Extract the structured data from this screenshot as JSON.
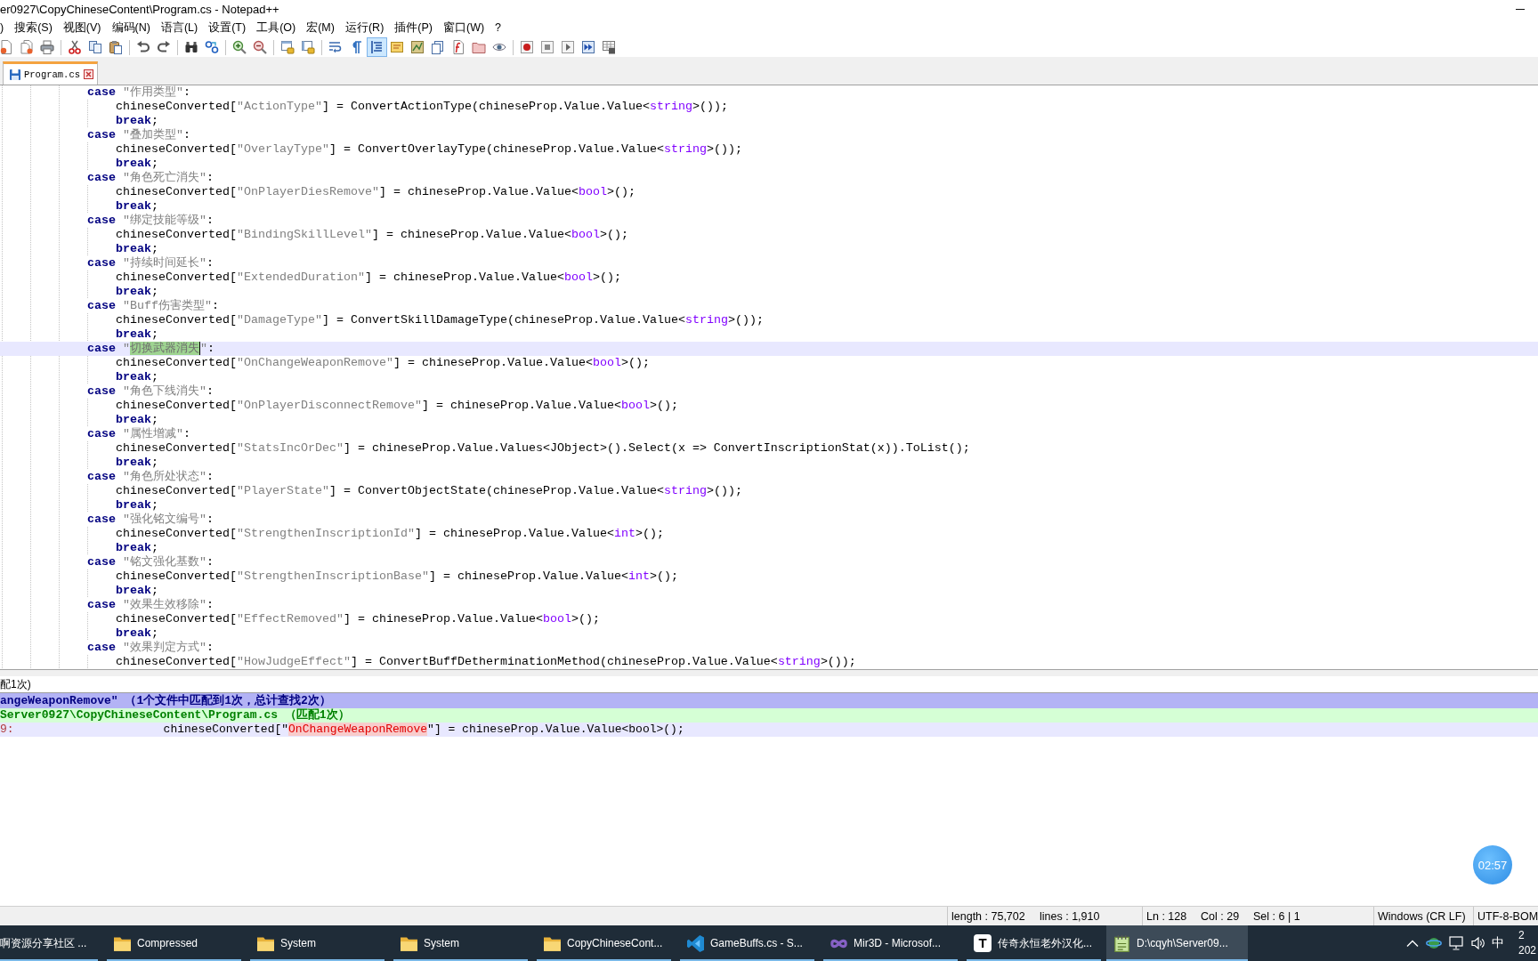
{
  "window": {
    "title": "er0927\\CopyChineseContent\\Program.cs - Notepad++"
  },
  "menu": [
    ")",
    "搜索(S)",
    "视图(V)",
    "编码(N)",
    "语言(L)",
    "设置(T)",
    "工具(O)",
    "宏(M)",
    "运行(R)",
    "插件(P)",
    "窗口(W)",
    "?"
  ],
  "toolbar": [
    [
      {
        "pressed": false
      },
      {
        "pressed": false
      },
      {
        "pressed": false
      }
    ],
    [
      {
        "pressed": false
      },
      {
        "pressed": false
      },
      {
        "pressed": false
      }
    ],
    [
      {
        "pressed": false
      },
      {
        "pressed": false
      }
    ],
    [
      {
        "pressed": false
      },
      {
        "pressed": false
      }
    ],
    [
      {
        "pressed": false
      },
      {
        "pressed": false
      }
    ],
    [
      {
        "pressed": false
      },
      {
        "pressed": false
      }
    ],
    [
      {
        "pressed": false
      },
      {
        "pressed": false
      },
      {
        "pressed": true
      },
      {
        "pressed": false
      },
      {
        "pressed": false
      },
      {
        "pressed": false
      },
      {
        "pressed": false
      },
      {
        "pressed": false
      },
      {
        "pressed": false
      }
    ],
    [
      {
        "pressed": false
      },
      {
        "pressed": false
      },
      {
        "pressed": false
      },
      {
        "pressed": false
      },
      {
        "pressed": false
      }
    ]
  ],
  "tabs": [
    {
      "label": "Program.cs",
      "selected": true
    }
  ],
  "editor": {
    "cases": [
      {
        "current": false,
        "tokens": [
          {
            "kind": "kw",
            "text": "case"
          },
          {
            "kind": "str",
            "text": " \"作用类型\""
          },
          {
            "kind": "code",
            "text": ":"
          }
        ],
        "children": [
          {
            "tokens": [
              {
                "kind": "code",
                "text": "chineseConverted["
              },
              {
                "kind": "str",
                "text": "\"ActionType\""
              },
              {
                "kind": "code",
                "text": "] = ConvertActionType(chineseProp.Value.Value<"
              },
              {
                "kind": "type",
                "text": "string"
              },
              {
                "kind": "code",
                "text": ">());"
              }
            ]
          },
          {
            "tokens": [
              {
                "kind": "kw",
                "text": "break"
              },
              {
                "kind": "code",
                "text": ";"
              }
            ]
          }
        ]
      },
      {
        "current": false,
        "tokens": [
          {
            "kind": "kw",
            "text": "case"
          },
          {
            "kind": "str",
            "text": " \"叠加类型\""
          },
          {
            "kind": "code",
            "text": ":"
          }
        ],
        "children": [
          {
            "tokens": [
              {
                "kind": "code",
                "text": "chineseConverted["
              },
              {
                "kind": "str",
                "text": "\"OverlayType\""
              },
              {
                "kind": "code",
                "text": "] = ConvertOverlayType(chineseProp.Value.Value<"
              },
              {
                "kind": "type",
                "text": "string"
              },
              {
                "kind": "code",
                "text": ">());"
              }
            ]
          },
          {
            "tokens": [
              {
                "kind": "kw",
                "text": "break"
              },
              {
                "kind": "code",
                "text": ";"
              }
            ]
          }
        ]
      },
      {
        "current": false,
        "tokens": [
          {
            "kind": "kw",
            "text": "case"
          },
          {
            "kind": "str",
            "text": " \"角色死亡消失\""
          },
          {
            "kind": "code",
            "text": ":"
          }
        ],
        "children": [
          {
            "tokens": [
              {
                "kind": "code",
                "text": "chineseConverted["
              },
              {
                "kind": "str",
                "text": "\"OnPlayerDiesRemove\""
              },
              {
                "kind": "code",
                "text": "] = chineseProp.Value.Value<"
              },
              {
                "kind": "type",
                "text": "bool"
              },
              {
                "kind": "code",
                "text": ">();"
              }
            ]
          },
          {
            "tokens": [
              {
                "kind": "kw",
                "text": "break"
              },
              {
                "kind": "code",
                "text": ";"
              }
            ]
          }
        ]
      },
      {
        "current": false,
        "tokens": [
          {
            "kind": "kw",
            "text": "case"
          },
          {
            "kind": "str",
            "text": " \"绑定技能等级\""
          },
          {
            "kind": "code",
            "text": ":"
          }
        ],
        "children": [
          {
            "tokens": [
              {
                "kind": "code",
                "text": "chineseConverted["
              },
              {
                "kind": "str",
                "text": "\"BindingSkillLevel\""
              },
              {
                "kind": "code",
                "text": "] = chineseProp.Value.Value<"
              },
              {
                "kind": "type",
                "text": "bool"
              },
              {
                "kind": "code",
                "text": ">();"
              }
            ]
          },
          {
            "tokens": [
              {
                "kind": "kw",
                "text": "break"
              },
              {
                "kind": "code",
                "text": ";"
              }
            ]
          }
        ]
      },
      {
        "current": false,
        "tokens": [
          {
            "kind": "kw",
            "text": "case"
          },
          {
            "kind": "str",
            "text": " \"持续时间延长\""
          },
          {
            "kind": "code",
            "text": ":"
          }
        ],
        "children": [
          {
            "tokens": [
              {
                "kind": "code",
                "text": "chineseConverted["
              },
              {
                "kind": "str",
                "text": "\"ExtendedDuration\""
              },
              {
                "kind": "code",
                "text": "] = chineseProp.Value.Value<"
              },
              {
                "kind": "type",
                "text": "bool"
              },
              {
                "kind": "code",
                "text": ">();"
              }
            ]
          },
          {
            "tokens": [
              {
                "kind": "kw",
                "text": "break"
              },
              {
                "kind": "code",
                "text": ";"
              }
            ]
          }
        ]
      },
      {
        "current": false,
        "tokens": [
          {
            "kind": "kw",
            "text": "case"
          },
          {
            "kind": "str",
            "text": " \"Buff伤害类型\""
          },
          {
            "kind": "code",
            "text": ":"
          }
        ],
        "children": [
          {
            "tokens": [
              {
                "kind": "code",
                "text": "chineseConverted["
              },
              {
                "kind": "str",
                "text": "\"DamageType\""
              },
              {
                "kind": "code",
                "text": "] = ConvertSkillDamageType(chineseProp.Value.Value<"
              },
              {
                "kind": "type",
                "text": "string"
              },
              {
                "kind": "code",
                "text": ">());"
              }
            ]
          },
          {
            "tokens": [
              {
                "kind": "kw",
                "text": "break"
              },
              {
                "kind": "code",
                "text": ";"
              }
            ]
          }
        ]
      },
      {
        "current": true,
        "tokens": [
          {
            "kind": "kw",
            "text": "case"
          },
          {
            "kind": "str",
            "text": " \""
          },
          {
            "kind": "sel",
            "text": "切换武器消失"
          },
          {
            "kind": "str",
            "text": "\""
          },
          {
            "kind": "code",
            "text": ":"
          }
        ],
        "children": [
          {
            "tokens": [
              {
                "kind": "code",
                "text": "chineseConverted["
              },
              {
                "kind": "str",
                "text": "\"OnChangeWeaponRemove\""
              },
              {
                "kind": "code",
                "text": "] = chineseProp.Value.Value<"
              },
              {
                "kind": "type",
                "text": "bool"
              },
              {
                "kind": "code",
                "text": ">();"
              }
            ]
          },
          {
            "tokens": [
              {
                "kind": "kw",
                "text": "break"
              },
              {
                "kind": "code",
                "text": ";"
              }
            ]
          }
        ]
      },
      {
        "current": false,
        "tokens": [
          {
            "kind": "kw",
            "text": "case"
          },
          {
            "kind": "str",
            "text": " \"角色下线消失\""
          },
          {
            "kind": "code",
            "text": ":"
          }
        ],
        "children": [
          {
            "tokens": [
              {
                "kind": "code",
                "text": "chineseConverted["
              },
              {
                "kind": "str",
                "text": "\"OnPlayerDisconnectRemove\""
              },
              {
                "kind": "code",
                "text": "] = chineseProp.Value.Value<"
              },
              {
                "kind": "type",
                "text": "bool"
              },
              {
                "kind": "code",
                "text": ">();"
              }
            ]
          },
          {
            "tokens": [
              {
                "kind": "kw",
                "text": "break"
              },
              {
                "kind": "code",
                "text": ";"
              }
            ]
          }
        ]
      },
      {
        "current": false,
        "tokens": [
          {
            "kind": "kw",
            "text": "case"
          },
          {
            "kind": "str",
            "text": " \"属性增减\""
          },
          {
            "kind": "code",
            "text": ":"
          }
        ],
        "children": [
          {
            "tokens": [
              {
                "kind": "code",
                "text": "chineseConverted["
              },
              {
                "kind": "str",
                "text": "\"StatsIncOrDec\""
              },
              {
                "kind": "code",
                "text": "] = chineseProp.Value.Values<JObject>().Select(x => ConvertInscriptionStat(x)).ToList();"
              }
            ]
          },
          {
            "tokens": [
              {
                "kind": "kw",
                "text": "break"
              },
              {
                "kind": "code",
                "text": ";"
              }
            ]
          }
        ]
      },
      {
        "current": false,
        "tokens": [
          {
            "kind": "kw",
            "text": "case"
          },
          {
            "kind": "str",
            "text": " \"角色所处状态\""
          },
          {
            "kind": "code",
            "text": ":"
          }
        ],
        "children": [
          {
            "tokens": [
              {
                "kind": "code",
                "text": "chineseConverted["
              },
              {
                "kind": "str",
                "text": "\"PlayerState\""
              },
              {
                "kind": "code",
                "text": "] = ConvertObjectState(chineseProp.Value.Value<"
              },
              {
                "kind": "type",
                "text": "string"
              },
              {
                "kind": "code",
                "text": ">());"
              }
            ]
          },
          {
            "tokens": [
              {
                "kind": "kw",
                "text": "break"
              },
              {
                "kind": "code",
                "text": ";"
              }
            ]
          }
        ]
      },
      {
        "current": false,
        "tokens": [
          {
            "kind": "kw",
            "text": "case"
          },
          {
            "kind": "str",
            "text": " \"强化铭文编号\""
          },
          {
            "kind": "code",
            "text": ":"
          }
        ],
        "children": [
          {
            "tokens": [
              {
                "kind": "code",
                "text": "chineseConverted["
              },
              {
                "kind": "str",
                "text": "\"StrengthenInscriptionId\""
              },
              {
                "kind": "code",
                "text": "] = chineseProp.Value.Value<"
              },
              {
                "kind": "type",
                "text": "int"
              },
              {
                "kind": "code",
                "text": ">();"
              }
            ]
          },
          {
            "tokens": [
              {
                "kind": "kw",
                "text": "break"
              },
              {
                "kind": "code",
                "text": ";"
              }
            ]
          }
        ]
      },
      {
        "current": false,
        "tokens": [
          {
            "kind": "kw",
            "text": "case"
          },
          {
            "kind": "str",
            "text": " \"铭文强化基数\""
          },
          {
            "kind": "code",
            "text": ":"
          }
        ],
        "children": [
          {
            "tokens": [
              {
                "kind": "code",
                "text": "chineseConverted["
              },
              {
                "kind": "str",
                "text": "\"StrengthenInscriptionBase\""
              },
              {
                "kind": "code",
                "text": "] = chineseProp.Value.Value<"
              },
              {
                "kind": "type",
                "text": "int"
              },
              {
                "kind": "code",
                "text": ">();"
              }
            ]
          },
          {
            "tokens": [
              {
                "kind": "kw",
                "text": "break"
              },
              {
                "kind": "code",
                "text": ";"
              }
            ]
          }
        ]
      },
      {
        "current": false,
        "tokens": [
          {
            "kind": "kw",
            "text": "case"
          },
          {
            "kind": "str",
            "text": " \"效果生效移除\""
          },
          {
            "kind": "code",
            "text": ":"
          }
        ],
        "children": [
          {
            "tokens": [
              {
                "kind": "code",
                "text": "chineseConverted["
              },
              {
                "kind": "str",
                "text": "\"EffectRemoved\""
              },
              {
                "kind": "code",
                "text": "] = chineseProp.Value.Value<"
              },
              {
                "kind": "type",
                "text": "bool"
              },
              {
                "kind": "code",
                "text": ">();"
              }
            ]
          },
          {
            "tokens": [
              {
                "kind": "kw",
                "text": "break"
              },
              {
                "kind": "code",
                "text": ";"
              }
            ]
          }
        ]
      },
      {
        "current": false,
        "tokens": [
          {
            "kind": "kw",
            "text": "case"
          },
          {
            "kind": "str",
            "text": " \"效果判定方式\""
          },
          {
            "kind": "code",
            "text": ":"
          }
        ],
        "children": [
          {
            "tokens": [
              {
                "kind": "code",
                "text": "chineseConverted["
              },
              {
                "kind": "str",
                "text": "\"HowJudgeEffect\""
              },
              {
                "kind": "code",
                "text": "] = ConvertBuffDetherminationMethod(chineseProp.Value.Value<"
              },
              {
                "kind": "type",
                "text": "string"
              },
              {
                "kind": "code",
                "text": ">());"
              }
            ]
          }
        ]
      }
    ]
  },
  "search_results": {
    "title": "配1次)",
    "summary": "angeWeaponRemove\" （1个文件中匹配到1次，总计查找2次）",
    "file": "Server0927\\CopyChineseContent\\Program.cs （匹配1次）",
    "hits": [
      {
        "current": true,
        "line_number": "9:",
        "tokens": [
          {
            "kind": "code",
            "text": "chineseConverted[\""
          },
          {
            "kind": "match",
            "text": "OnChangeWeaponRemove"
          },
          {
            "kind": "code",
            "text": "\"] = chineseProp.Value.Value<bool>();"
          }
        ]
      }
    ]
  },
  "status_bar": {
    "length": "length : 75,702",
    "lines": "lines : 1,910",
    "line": "Ln : 128",
    "column": "Col : 29",
    "selection": "Sel : 6 | 1",
    "eol": "Windows (CR LF)",
    "encoding": "UTF-8-BOM"
  },
  "taskbar": {
    "items": [
      {
        "kind": "label",
        "label": "啊资源分享社区 ...",
        "running": true,
        "selected": false
      },
      {
        "kind": "folder",
        "label": "Compressed",
        "running": true,
        "selected": false
      },
      {
        "kind": "folder",
        "label": "System",
        "running": true,
        "selected": false
      },
      {
        "kind": "folder",
        "label": "System",
        "running": true,
        "selected": false
      },
      {
        "kind": "folder",
        "label": "CopyChineseCont...",
        "running": true,
        "selected": false
      },
      {
        "kind": "editor",
        "label": "GameBuffs.cs - S...",
        "running": true,
        "selected": false
      },
      {
        "kind": "ide",
        "label": "Mir3D - Microsof...",
        "running": true,
        "selected": false
      },
      {
        "kind": "letter",
        "glyph": "T",
        "label": "传奇永恒老外汉化...",
        "running": true,
        "selected": false
      },
      {
        "kind": "notepad",
        "label": "D:\\cqyh\\Server09...",
        "running": true,
        "selected": true
      }
    ],
    "tray": {
      "ime": "中",
      "clock_time": "2",
      "clock_date": "202"
    }
  },
  "recording_timer": {
    "text": "02:57"
  }
}
